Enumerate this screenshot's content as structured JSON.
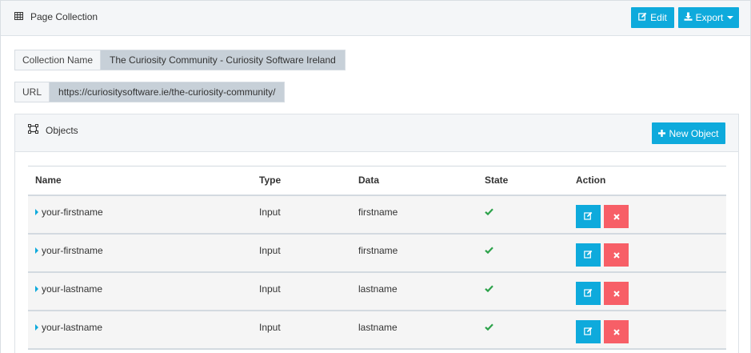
{
  "header": {
    "title": "Page Collection",
    "edit_label": "Edit",
    "export_label": "Export"
  },
  "fields": {
    "collection_name_label": "Collection Name",
    "collection_name_value": "The Curiosity Community - Curiosity Software Ireland",
    "url_label": "URL",
    "url_value": "https://curiositysoftware.ie/the-curiosity-community/"
  },
  "objects": {
    "title": "Objects",
    "new_object_label": "New Object",
    "columns": [
      "Name",
      "Type",
      "Data",
      "State",
      "Action"
    ],
    "rows": [
      {
        "name": "your-firstname",
        "type": "Input",
        "data": "firstname"
      },
      {
        "name": "your-firstname",
        "type": "Input",
        "data": "firstname"
      },
      {
        "name": "your-lastname",
        "type": "Input",
        "data": "lastname"
      },
      {
        "name": "your-lastname",
        "type": "Input",
        "data": "lastname"
      }
    ]
  },
  "colors": {
    "primary": "#0eaadc",
    "danger": "#f75f67",
    "success": "#2ca24a"
  },
  "icons": {
    "panel": "table-icon",
    "edit": "edit-icon",
    "export": "download-icon",
    "objects": "objects-icon",
    "state": "check-icon",
    "row_edit": "edit-icon",
    "row_delete": "close-icon",
    "expand": "caret-right-icon"
  }
}
